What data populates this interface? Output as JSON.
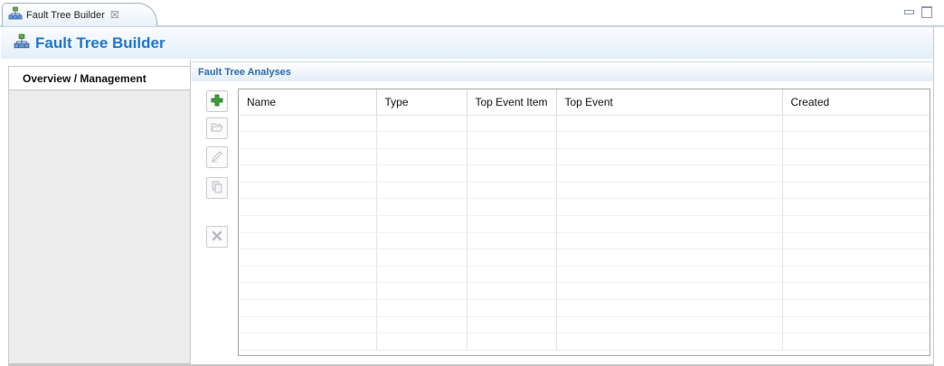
{
  "editor_tab": {
    "label": "Fault Tree Builder",
    "close_glyph": "☒"
  },
  "header": {
    "title": "Fault Tree Builder"
  },
  "sidebar": {
    "items": [
      {
        "label": "Overview / Management",
        "selected": true
      }
    ]
  },
  "section": {
    "title": "Fault Tree Analyses"
  },
  "toolbar": [
    {
      "name": "add-icon",
      "enabled": true
    },
    {
      "name": "open-icon",
      "enabled": false
    },
    {
      "name": "edit-icon",
      "enabled": false
    },
    {
      "name": "copy-icon",
      "enabled": false
    },
    {
      "name": "delete-icon",
      "enabled": false
    }
  ],
  "table": {
    "columns": [
      "Name",
      "Type",
      "Top Event Item",
      "Top Event",
      "Created"
    ],
    "rows": []
  },
  "colors": {
    "accent": "#1f77d0",
    "section_title": "#2a6cb4",
    "add_green": "#3aa13a"
  }
}
